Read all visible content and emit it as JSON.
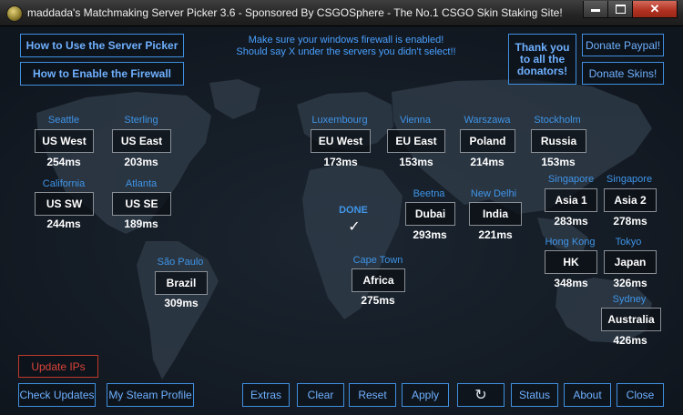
{
  "window": {
    "title": "maddada's Matchmaking Server Picker 3.6 - Sponsored By CSGOSphere - The No.1 CSGO Skin Staking Site!",
    "close_glyph": "✕"
  },
  "top": {
    "how_to_use": "How to Use the Server Picker",
    "how_to_firewall": "How to Enable the Firewall",
    "notice_line1": "Make sure your windows firewall is enabled!",
    "notice_line2": "Should say X under the servers you didn't select!!",
    "thank_you": "Thank you to all the donators!",
    "donate_paypal": "Donate Paypal!",
    "donate_skins": "Donate Skins!"
  },
  "status": {
    "done_label": "DONE",
    "done_mark": "✓"
  },
  "servers": {
    "seattle": {
      "city": "Seattle",
      "name": "US West",
      "ping": "254ms"
    },
    "sterling": {
      "city": "Sterling",
      "name": "US East",
      "ping": "203ms"
    },
    "california": {
      "city": "California",
      "name": "US SW",
      "ping": "244ms"
    },
    "atlanta": {
      "city": "Atlanta",
      "name": "US SE",
      "ping": "189ms"
    },
    "saopaulo": {
      "city": "São Paulo",
      "name": "Brazil",
      "ping": "309ms"
    },
    "luxembourg": {
      "city": "Luxembourg",
      "name": "EU West",
      "ping": "173ms"
    },
    "vienna": {
      "city": "Vienna",
      "name": "EU East",
      "ping": "153ms"
    },
    "warszawa": {
      "city": "Warszawa",
      "name": "Poland",
      "ping": "214ms"
    },
    "stockholm": {
      "city": "Stockholm",
      "name": "Russia",
      "ping": "153ms"
    },
    "beetna": {
      "city": "Beetna",
      "name": "Dubai",
      "ping": "293ms"
    },
    "newdelhi": {
      "city": "New Delhi",
      "name": "India",
      "ping": "221ms"
    },
    "capetown": {
      "city": "Cape Town",
      "name": "Africa",
      "ping": "275ms"
    },
    "singapore1": {
      "city": "Singapore",
      "name": "Asia 1",
      "ping": "283ms"
    },
    "singapore2": {
      "city": "Singapore",
      "name": "Asia 2",
      "ping": "278ms"
    },
    "hongkong": {
      "city": "Hong Kong",
      "name": "HK",
      "ping": "348ms"
    },
    "tokyo": {
      "city": "Tokyo",
      "name": "Japan",
      "ping": "326ms"
    },
    "sydney": {
      "city": "Sydney",
      "name": "Australia",
      "ping": "426ms"
    }
  },
  "bottom": {
    "update_ips": "Update IPs",
    "check_updates": "Check Updates",
    "my_steam_profile": "My Steam Profile",
    "extras": "Extras",
    "clear": "Clear",
    "reset": "Reset",
    "apply": "Apply",
    "refresh_glyph": "↻",
    "status": "Status",
    "about": "About",
    "close": "Close"
  },
  "colors": {
    "accent": "#3f8fe0",
    "alert": "#c0392b",
    "background": "#141b24"
  }
}
